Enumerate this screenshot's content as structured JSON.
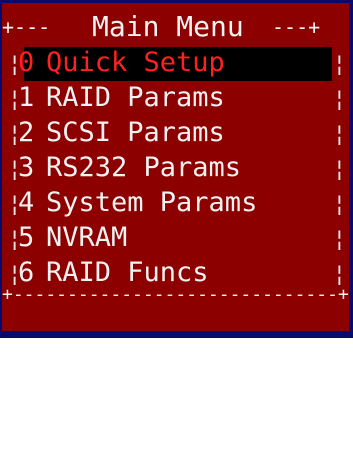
{
  "menu": {
    "title": "Main Menu",
    "top_left_border": "+---",
    "top_right_border": "---+",
    "bottom_border": "+------------------------------+",
    "items": [
      {
        "num": "0",
        "label": "Quick Setup"
      },
      {
        "num": "1",
        "label": "RAID Params"
      },
      {
        "num": "2",
        "label": "SCSI Params"
      },
      {
        "num": "3",
        "label": "RS232 Params"
      },
      {
        "num": "4",
        "label": "System Params"
      },
      {
        "num": "5",
        "label": "NVRAM"
      },
      {
        "num": "6",
        "label": "RAID Funcs"
      }
    ],
    "selected_index": 0,
    "colors": {
      "panel_bg": "#8c0000",
      "outer_bg": "#0a0a6e",
      "text": "#f2f2f2",
      "selected_text": "#ff2020",
      "selected_bg": "#000000"
    }
  }
}
